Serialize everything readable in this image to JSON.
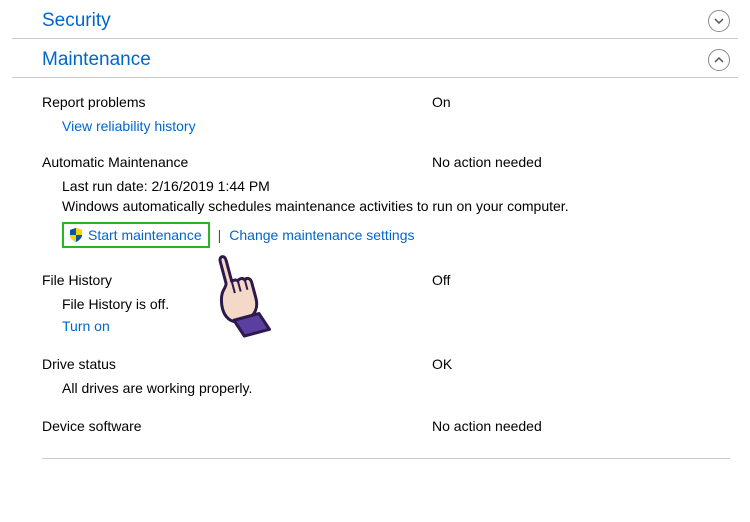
{
  "sections": {
    "security": {
      "title": "Security"
    },
    "maintenance": {
      "title": "Maintenance",
      "report_problems": {
        "label": "Report problems",
        "status": "On",
        "link": "View reliability history"
      },
      "automatic": {
        "label": "Automatic Maintenance",
        "status": "No action needed",
        "last_run_label": "Last run date: 2/16/2019 1:44 PM",
        "desc": "Windows automatically schedules maintenance activities to run on your computer.",
        "start_link": "Start maintenance",
        "change_link": "Change maintenance settings"
      },
      "file_history": {
        "label": "File History",
        "status": "Off",
        "sub": "File History is off.",
        "link": "Turn on"
      },
      "drive_status": {
        "label": "Drive status",
        "status": "OK",
        "sub": "All drives are working properly."
      },
      "device_software": {
        "label": "Device software",
        "status": "No action needed"
      }
    }
  }
}
